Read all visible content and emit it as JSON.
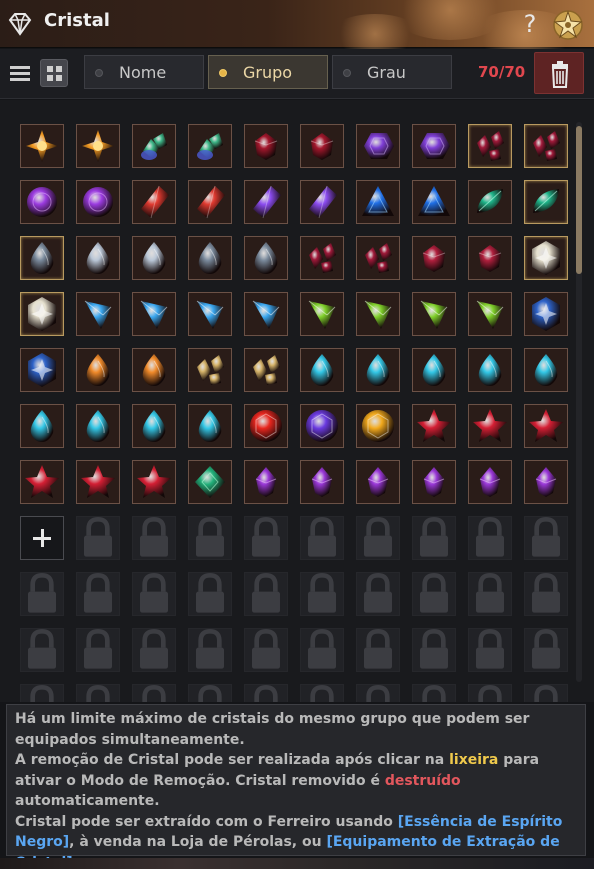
{
  "window": {
    "title": "Cristal",
    "help_label": "?"
  },
  "toolbar": {
    "tabs": [
      {
        "label": "Nome",
        "active": false
      },
      {
        "label": "Grupo",
        "active": true
      },
      {
        "label": "Grau",
        "active": false
      }
    ],
    "count": "70/70",
    "accent_color": "#e0474e"
  },
  "inventory": {
    "columns": 10,
    "filled_slots": 64,
    "add_slot_row": 7,
    "gems": [
      {
        "icon": "orange-fire-gem-icon",
        "color": "#f29a22",
        "shape": "spark"
      },
      {
        "icon": "orange-fire-gem-icon",
        "color": "#f29a22",
        "shape": "spark"
      },
      {
        "icon": "green-blue-gem-icon",
        "color": "#3fb98a",
        "shape": "cluster"
      },
      {
        "icon": "green-blue-gem-icon",
        "color": "#3fb98a",
        "shape": "cluster"
      },
      {
        "icon": "dark-red-gem-icon",
        "color": "#a3172c",
        "shape": "round"
      },
      {
        "icon": "dark-red-gem-icon",
        "color": "#a3172c",
        "shape": "round"
      },
      {
        "icon": "purple-hexagon-gem-icon",
        "color": "#7f3fd6",
        "shape": "hexagon"
      },
      {
        "icon": "purple-hexagon-gem-icon",
        "color": "#7f3fd6",
        "shape": "hexagon"
      },
      {
        "icon": "dark-red-shard-gem-icon",
        "color": "#a01a3a",
        "shape": "shards"
      },
      {
        "icon": "dark-red-shard-gem-icon",
        "color": "#a01a3a",
        "shape": "shards"
      },
      {
        "icon": "purple-orb-gem-icon",
        "color": "#9b3be0",
        "shape": "orb"
      },
      {
        "icon": "purple-orb-gem-icon",
        "color": "#9b3be0",
        "shape": "orb"
      },
      {
        "icon": "red-crystal-gem-icon",
        "color": "#e03a30",
        "shape": "diamond"
      },
      {
        "icon": "red-crystal-gem-icon",
        "color": "#e03a30",
        "shape": "diamond"
      },
      {
        "icon": "violet-crystal-gem-icon",
        "color": "#8c4cf0",
        "shape": "diamond"
      },
      {
        "icon": "violet-crystal-gem-icon",
        "color": "#8c4cf0",
        "shape": "diamond"
      },
      {
        "icon": "blue-triangle-gem-icon",
        "color": "#1f6fe6",
        "shape": "triangle"
      },
      {
        "icon": "blue-triangle-gem-icon",
        "color": "#1f6fe6",
        "shape": "triangle"
      },
      {
        "icon": "teal-leaf-gem-icon",
        "color": "#1fb58a",
        "shape": "leaf"
      },
      {
        "icon": "teal-leaf-gem-icon",
        "color": "#1fb58a",
        "shape": "leaf"
      },
      {
        "icon": "dark-teardrop-gem-icon",
        "color": "#7a8a9c",
        "shape": "drop"
      },
      {
        "icon": "silver-teardrop-gem-icon",
        "color": "#b9c6d6",
        "shape": "drop"
      },
      {
        "icon": "silver-teardrop-gem-icon",
        "color": "#b9c6d6",
        "shape": "drop"
      },
      {
        "icon": "dark-teardrop-gem-icon",
        "color": "#7a8a9c",
        "shape": "drop"
      },
      {
        "icon": "dark-teardrop-gem-icon",
        "color": "#7a8a9c",
        "shape": "drop"
      },
      {
        "icon": "dark-red-shard-gem-icon",
        "color": "#a01a3a",
        "shape": "shards"
      },
      {
        "icon": "dark-red-shard-gem-icon",
        "color": "#a01a3a",
        "shape": "shards"
      },
      {
        "icon": "crimson-gem-icon",
        "color": "#b01f3d",
        "shape": "round"
      },
      {
        "icon": "crimson-gem-icon",
        "color": "#b01f3d",
        "shape": "round"
      },
      {
        "icon": "white-star-gem-icon",
        "color": "#e7e2d0",
        "shape": "hexstar"
      },
      {
        "icon": "white-star-gem-icon",
        "color": "#e7e2d0",
        "shape": "hexstar"
      },
      {
        "icon": "blue-prism-gem-icon",
        "color": "#3aa7f0",
        "shape": "prism"
      },
      {
        "icon": "blue-prism-gem-icon",
        "color": "#3aa7f0",
        "shape": "prism"
      },
      {
        "icon": "blue-prism-gem-icon",
        "color": "#3aa7f0",
        "shape": "prism"
      },
      {
        "icon": "blue-prism-gem-icon",
        "color": "#3aa7f0",
        "shape": "prism"
      },
      {
        "icon": "green-prism-gem-icon",
        "color": "#7fd02a",
        "shape": "prism"
      },
      {
        "icon": "green-prism-gem-icon",
        "color": "#7fd02a",
        "shape": "prism"
      },
      {
        "icon": "green-prism-gem-icon",
        "color": "#7fd02a",
        "shape": "prism"
      },
      {
        "icon": "green-prism-gem-icon",
        "color": "#7fd02a",
        "shape": "prism"
      },
      {
        "icon": "dark-blue-star-gem-icon",
        "color": "#2e63c9",
        "shape": "hexstar"
      },
      {
        "icon": "dark-blue-star-gem-icon",
        "color": "#2e63c9",
        "shape": "hexstar"
      },
      {
        "icon": "amber-drop-gem-icon",
        "color": "#f08a2a",
        "shape": "drop"
      },
      {
        "icon": "amber-drop-gem-icon",
        "color": "#f08a2a",
        "shape": "drop"
      },
      {
        "icon": "gold-shard-gem-icon",
        "color": "#d6b46a",
        "shape": "shards"
      },
      {
        "icon": "gold-shard-gem-icon",
        "color": "#d6b46a",
        "shape": "shards"
      },
      {
        "icon": "cyan-drop-gem-icon",
        "color": "#33c7e6",
        "shape": "drop"
      },
      {
        "icon": "cyan-drop-gem-icon",
        "color": "#33c7e6",
        "shape": "drop"
      },
      {
        "icon": "cyan-drop-gem-icon",
        "color": "#33c7e6",
        "shape": "drop"
      },
      {
        "icon": "cyan-drop-gem-icon",
        "color": "#33c7e6",
        "shape": "drop"
      },
      {
        "icon": "cyan-drop-gem-icon",
        "color": "#33c7e6",
        "shape": "drop"
      },
      {
        "icon": "cyan-drop-gem-icon",
        "color": "#33c7e6",
        "shape": "drop"
      },
      {
        "icon": "cyan-drop-gem-icon",
        "color": "#33c7e6",
        "shape": "drop"
      },
      {
        "icon": "cyan-drop-gem-icon",
        "color": "#33c7e6",
        "shape": "drop"
      },
      {
        "icon": "cyan-drop-gem-icon",
        "color": "#33c7e6",
        "shape": "drop"
      },
      {
        "icon": "red-round-gem-icon",
        "color": "#e8261e",
        "shape": "faceted"
      },
      {
        "icon": "violet-round-gem-icon",
        "color": "#6a3ae0",
        "shape": "faceted"
      },
      {
        "icon": "gold-round-gem-icon",
        "color": "#f2a91c",
        "shape": "faceted"
      },
      {
        "icon": "red-star-gem-icon",
        "color": "#d41f34",
        "shape": "star"
      },
      {
        "icon": "red-star-gem-icon",
        "color": "#d41f34",
        "shape": "star"
      },
      {
        "icon": "red-star-gem-icon",
        "color": "#d41f34",
        "shape": "star"
      },
      {
        "icon": "red-star-gem-icon",
        "color": "#d41f34",
        "shape": "star"
      },
      {
        "icon": "red-star-gem-icon",
        "color": "#d41f34",
        "shape": "star"
      },
      {
        "icon": "red-star-gem-icon",
        "color": "#d41f34",
        "shape": "star"
      },
      {
        "icon": "emerald-gem-icon",
        "color": "#22b07a",
        "shape": "emerald"
      },
      {
        "icon": "violet-pointed-gem-icon",
        "color": "#9a38d8",
        "shape": "pointed"
      },
      {
        "icon": "violet-pointed-gem-icon",
        "color": "#9a38d8",
        "shape": "pointed"
      },
      {
        "icon": "violet-pointed-gem-icon",
        "color": "#9a38d8",
        "shape": "pointed"
      },
      {
        "icon": "violet-pointed-gem-icon",
        "color": "#9a38d8",
        "shape": "pointed"
      },
      {
        "icon": "violet-pointed-gem-icon",
        "color": "#9a38d8",
        "shape": "pointed"
      },
      {
        "icon": "violet-pointed-gem-icon",
        "color": "#9a38d8",
        "shape": "pointed"
      }
    ]
  },
  "info": {
    "p1": "Há um limite máximo de cristais do mesmo grupo que podem ser equipados simultaneamente.",
    "p2_a": "A remoção de Cristal pode ser realizada após clicar na ",
    "p2_trash": "lixeira",
    "p2_b": " para ativar o Modo de Remoção. Cristal removido é ",
    "p2_destroyed": "destruído",
    "p2_c": " automaticamente.",
    "p3_a": "Cristal pode ser extraído com o Ferreiro usando ",
    "p3_item1": "[Essência de Espírito Negro]",
    "p3_b": ", à venda na Loja de Pérolas, ou ",
    "p3_item2": "[Equipamento de Extração de Cristal]",
    "p3_c": "."
  }
}
